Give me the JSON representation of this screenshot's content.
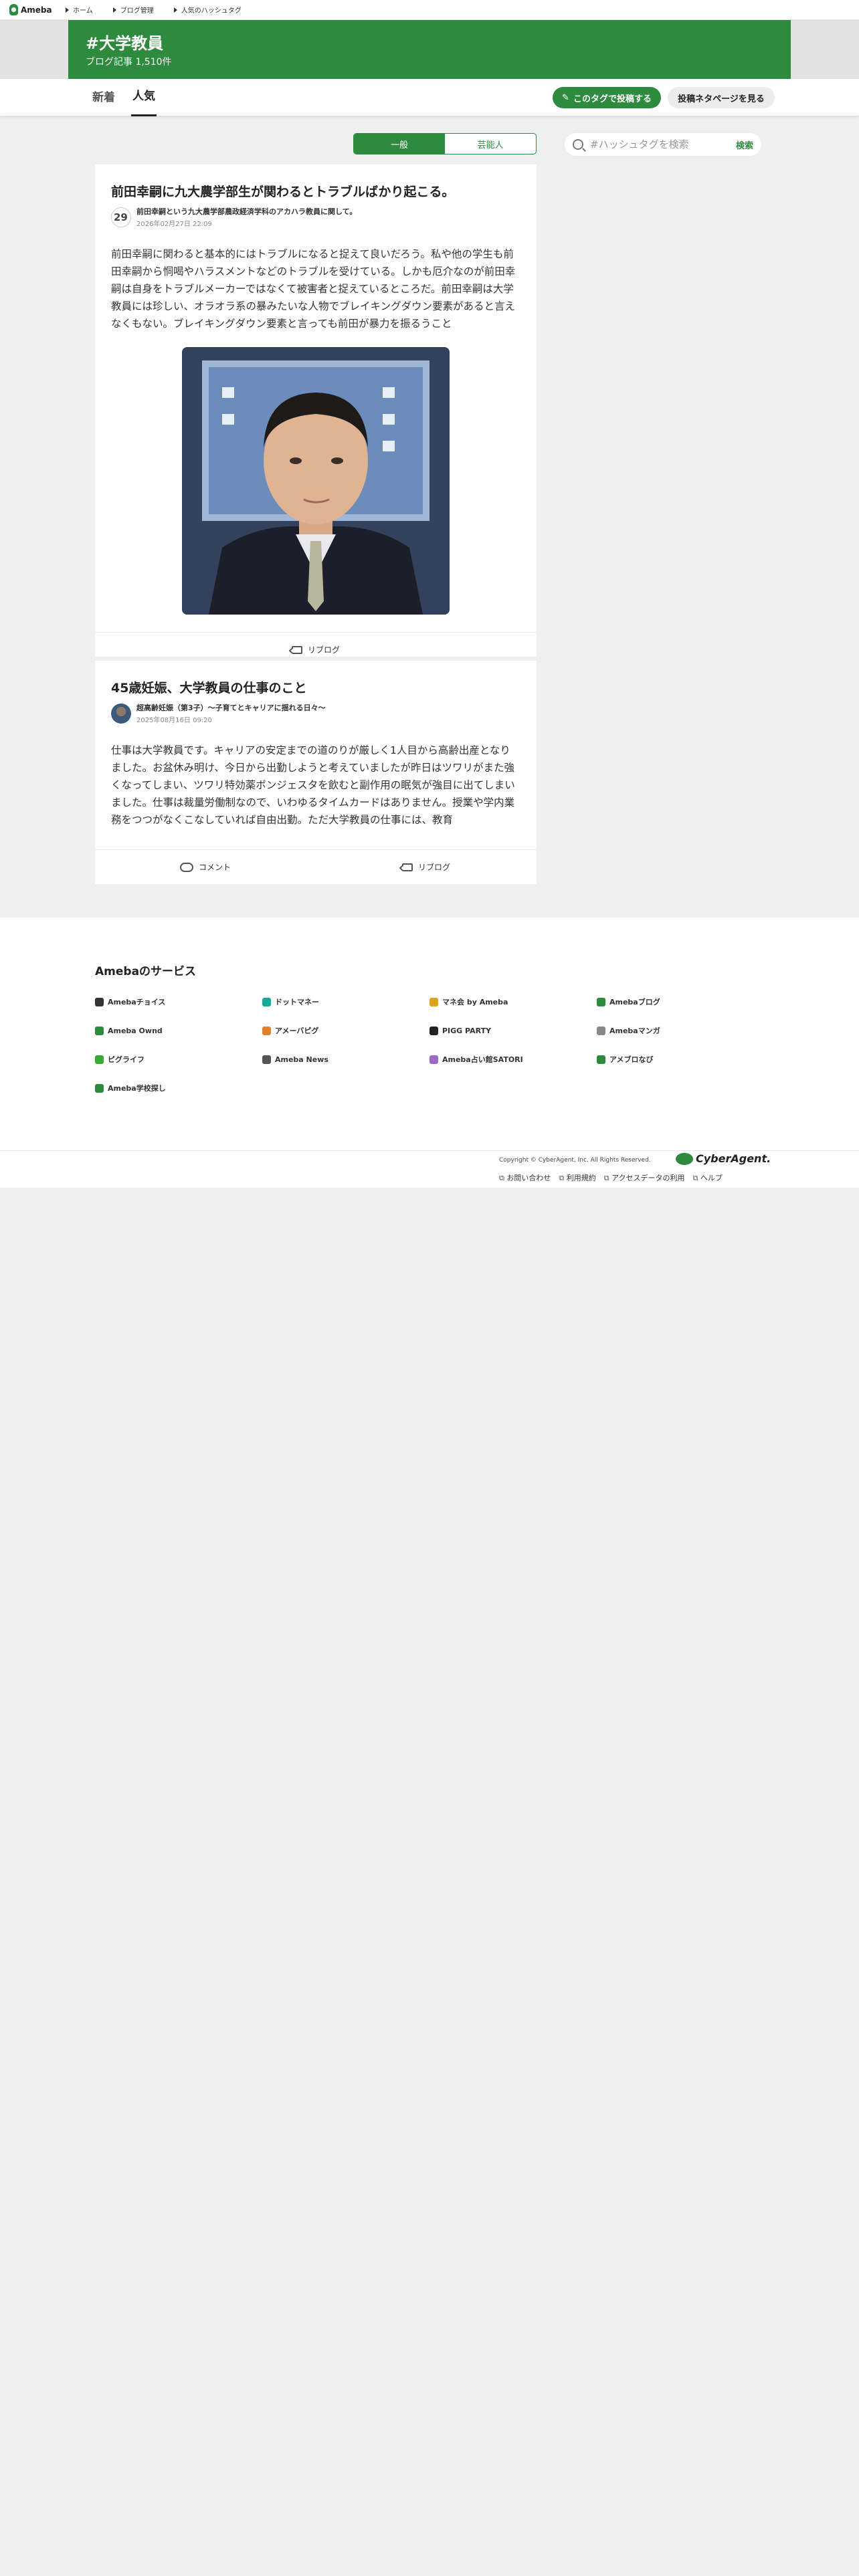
{
  "topnav": {
    "logo": "Ameba",
    "links": [
      "ホーム",
      "ブログ管理",
      "人気のハッシュタグ"
    ]
  },
  "hero": {
    "title": "#大学教員",
    "count": "ブログ記事 1,510件"
  },
  "tabs": [
    "新着",
    "人気"
  ],
  "active_tab": "人気",
  "actions": {
    "post_label": "このタグで投稿する",
    "view_label": "投稿ネタページを見る"
  },
  "filter": [
    "一般",
    "芸能人"
  ],
  "active_filter": "一般",
  "search": {
    "placeholder": "#ハッシュタグを検索",
    "button": "検索"
  },
  "posts": [
    {
      "title": "前田幸嗣に九大農学部生が関わるとトラブルばかり起こる。",
      "blog": "前田幸嗣という九大農学部農政経済学科のアカハラ教員に関して。",
      "date": "2026年02月27日 22:09",
      "excerpt": "前田幸嗣に関わると基本的にはトラブルになると捉えて良いだろう。私や他の学生も前田幸嗣から恫喝やハラスメントなどのトラブルを受けている。しかも厄介なのが前田幸嗣は自身をトラブルメーカーではなくて被害者と捉えているところだ。前田幸嗣は大学教員には珍しい、オラオラ系の暴みたいな人物でブレイキングダウン要素があると言えなくもない。ブレイキングダウン要素と言っても前田が暴力を振るうこと",
      "reblog": "リブログ"
    },
    {
      "title": "45歳妊娠、大学教員の仕事のこと",
      "blog": "超高齢妊娠（第3子）〜子育てとキャリアに揺れる日々〜",
      "date": "2025年08月16日 09:20",
      "excerpt": "仕事は大学教員です。キャリアの安定までの道のりが厳しく1人目から高齢出産となりました。お盆休み明け、今日から出勤しようと考えていましたが昨日はツワリがまた強くなってしまい、ツワリ特効薬ボンジェスタを飲むと副作用の眠気が強目に出てしまいました。仕事は裁量労働制なので、いわゆるタイムカードはありません。授業や学内業務をつつがなくこなしていれば自由出勤。ただ大学教員の仕事には、教育",
      "comment": "コメント",
      "reblog": "リブログ"
    }
  ],
  "services": {
    "title": "Amebaのサービス",
    "items": [
      {
        "label": "Amebaチョイス",
        "color": "#333333"
      },
      {
        "label": "ドットマネー",
        "color": "#1aa89a"
      },
      {
        "label": "マネ会 by Ameba",
        "color": "#e0a020"
      },
      {
        "label": "Amebaブログ",
        "color": "#2d8a3e"
      },
      {
        "label": "Ameba Ownd",
        "color": "#2d8a3e"
      },
      {
        "label": "アメーバピグ",
        "color": "#e08030"
      },
      {
        "label": "PIGG PARTY",
        "color": "#222222"
      },
      {
        "label": "Amebaマンガ",
        "color": "#888888"
      },
      {
        "label": "ピグライフ",
        "color": "#3aaa35"
      },
      {
        "label": "Ameba News",
        "color": "#555555"
      },
      {
        "label": "Ameba占い館SATORI",
        "color": "#9b6bc4"
      },
      {
        "label": "アメブロなび",
        "color": "#2d8a3e"
      },
      {
        "label": "Ameba学校探し",
        "color": "#2d8a3e"
      }
    ]
  },
  "footer": {
    "copyright": "Copyright © CyberAgent, Inc. All Rights Reserved.",
    "brand": "CyberAgent.",
    "links": [
      "お問い合わせ",
      "利用規約",
      "アクセスデータの利用",
      "ヘルプ"
    ]
  },
  "colors": {
    "accent": "#2d8a3e",
    "page_bg": "#efefef"
  }
}
